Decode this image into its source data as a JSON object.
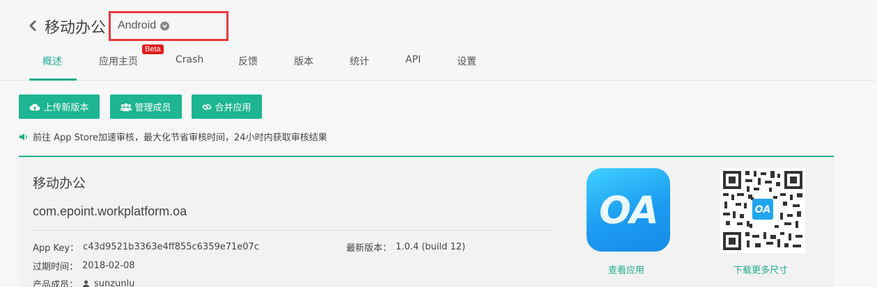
{
  "header": {
    "back_icon": "chevron-left-icon",
    "app_title": "移动办公",
    "platform": "Android",
    "platform_dropdown_icon": "chevron-down-circle-icon"
  },
  "tabs": [
    {
      "label": "概述",
      "active": true
    },
    {
      "label": "应用主页",
      "badge": "Beta"
    },
    {
      "label": "Crash"
    },
    {
      "label": "反馈"
    },
    {
      "label": "版本"
    },
    {
      "label": "统计"
    },
    {
      "label": "API"
    },
    {
      "label": "设置"
    }
  ],
  "actions": {
    "upload": "上传新版本",
    "members": "管理成员",
    "merge": "合并应用"
  },
  "notice": {
    "icon": "speaker-icon",
    "text": "前往 App Store加速审核，最大化节省审核时间，24小时内获取审核结果"
  },
  "card": {
    "name": "移动办公",
    "bundle_id": "com.epoint.workplatform.oa",
    "app_key_label": "App Key：",
    "app_key": "c43d9521b3363e4ff855c6359e71e07c",
    "latest_label": "最新版本：",
    "latest_version": "1.0.4 (build 12)",
    "expire_label": "过期时间：",
    "expire_date": "2018-02-08",
    "members_label": "产品成员：",
    "member": "sunzunlu",
    "icon_text": "OA",
    "view_app": "查看应用",
    "download_more": "下载更多尺寸",
    "qr_center_text": "OA"
  },
  "colors": {
    "accent": "#1fae8f",
    "button": "#1db592",
    "highlight_box": "#e8383d",
    "beta_badge": "#e41b1b"
  }
}
